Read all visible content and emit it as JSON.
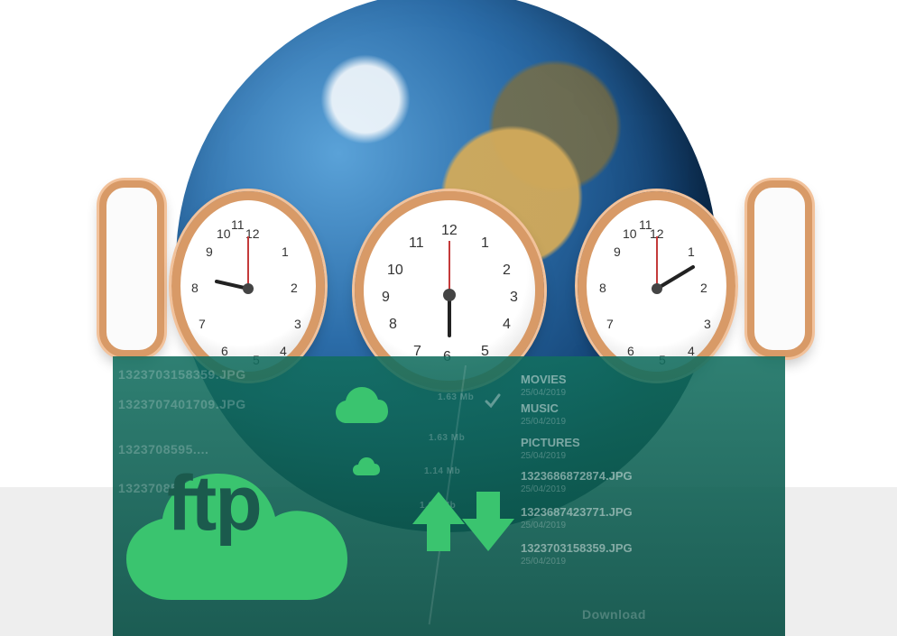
{
  "image": {
    "logo": {
      "text": "ftp"
    },
    "file_panel": {
      "items": [
        {
          "name": "MOVIES",
          "date": "25/04/2019"
        },
        {
          "name": "MUSIC",
          "date": "25/04/2019"
        },
        {
          "name": "PICTURES",
          "date": "25/04/2019"
        },
        {
          "name": "1323686872874.JPG",
          "date": "25/04/2019"
        },
        {
          "name": "1323687423771.JPG",
          "date": "25/04/2019"
        },
        {
          "name": "1323703158359.JPG",
          "date": "25/04/2019"
        }
      ],
      "left_items": [
        {
          "name": "1323703158359.JPG",
          "size": "1.63 Mb"
        },
        {
          "name": "1323707401709.JPG",
          "size": "1.63 Mb"
        },
        {
          "name": "1323708595....",
          "size": "1.14 Mb"
        },
        {
          "name": "1323708595....",
          "size": "1.65 Mb"
        }
      ],
      "download_label": "Download"
    },
    "colors": {
      "panel": "#126e5f",
      "ftp_green": "#3ac46f",
      "ftp_text": "#1b5a4d",
      "clock_frame": "#d89a67"
    },
    "icons": [
      "clock-icon",
      "cloud-icon",
      "upload-arrow-icon",
      "download-arrow-icon",
      "checkmark-icon"
    ]
  }
}
